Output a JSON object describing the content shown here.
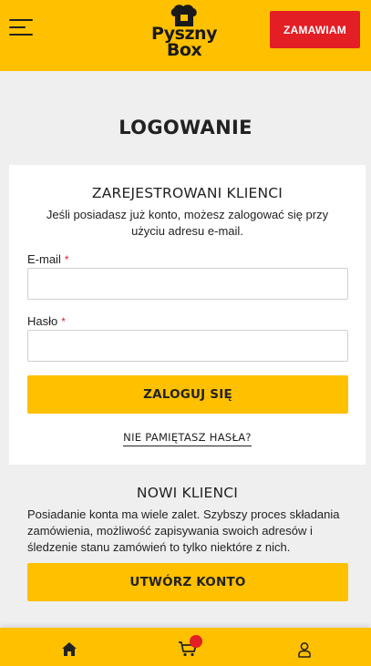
{
  "header": {
    "logo_line1": "Pyszny",
    "logo_line2": "Box",
    "order_button": "ZAMAWIAM"
  },
  "page_title": "LOGOWANIE",
  "registered": {
    "title": "ZAREJESTROWANI KLIENCI",
    "description": "Jeśli posiadasz już konto, możesz zalogować się przy użyciu adresu e-mail.",
    "email_label": "E-mail",
    "email_value": "",
    "password_label": "Hasło",
    "password_value": "",
    "required_mark": "*",
    "login_button": "ZALOGUJ SIĘ",
    "forgot_link": "NIE PAMIĘTASZ HASŁA?"
  },
  "new_customers": {
    "title": "NOWI KLIENCI",
    "description": "Posiadanie konta ma wiele zalet. Szybszy proces składania zamówienia, możliwość zapisywania swoich adresów i śledzenie stanu zamówień to tylko niektóre z nich.",
    "create_button": "UTWÓRZ KONTO"
  },
  "bottom_nav": {
    "icons": [
      "home-icon",
      "cart-icon",
      "user-icon"
    ]
  },
  "colors": {
    "brand_yellow": "#ffc000",
    "accent_red": "#e31e24",
    "page_bg": "#efefef"
  }
}
